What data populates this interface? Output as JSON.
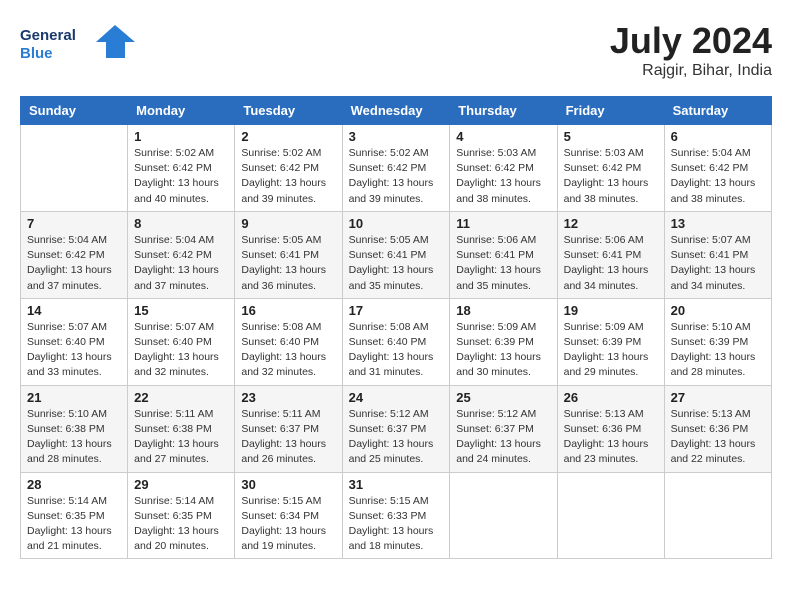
{
  "logo": {
    "line1": "General",
    "line2": "Blue"
  },
  "title": {
    "month_year": "July 2024",
    "location": "Rajgir, Bihar, India"
  },
  "days_of_week": [
    "Sunday",
    "Monday",
    "Tuesday",
    "Wednesday",
    "Thursday",
    "Friday",
    "Saturday"
  ],
  "weeks": [
    [
      {
        "day": "",
        "sunrise": "",
        "sunset": "",
        "daylight": ""
      },
      {
        "day": "1",
        "sunrise": "5:02 AM",
        "sunset": "6:42 PM",
        "daylight": "13 hours and 40 minutes."
      },
      {
        "day": "2",
        "sunrise": "5:02 AM",
        "sunset": "6:42 PM",
        "daylight": "13 hours and 39 minutes."
      },
      {
        "day": "3",
        "sunrise": "5:02 AM",
        "sunset": "6:42 PM",
        "daylight": "13 hours and 39 minutes."
      },
      {
        "day": "4",
        "sunrise": "5:03 AM",
        "sunset": "6:42 PM",
        "daylight": "13 hours and 38 minutes."
      },
      {
        "day": "5",
        "sunrise": "5:03 AM",
        "sunset": "6:42 PM",
        "daylight": "13 hours and 38 minutes."
      },
      {
        "day": "6",
        "sunrise": "5:04 AM",
        "sunset": "6:42 PM",
        "daylight": "13 hours and 38 minutes."
      }
    ],
    [
      {
        "day": "7",
        "sunrise": "5:04 AM",
        "sunset": "6:42 PM",
        "daylight": "13 hours and 37 minutes."
      },
      {
        "day": "8",
        "sunrise": "5:04 AM",
        "sunset": "6:42 PM",
        "daylight": "13 hours and 37 minutes."
      },
      {
        "day": "9",
        "sunrise": "5:05 AM",
        "sunset": "6:41 PM",
        "daylight": "13 hours and 36 minutes."
      },
      {
        "day": "10",
        "sunrise": "5:05 AM",
        "sunset": "6:41 PM",
        "daylight": "13 hours and 35 minutes."
      },
      {
        "day": "11",
        "sunrise": "5:06 AM",
        "sunset": "6:41 PM",
        "daylight": "13 hours and 35 minutes."
      },
      {
        "day": "12",
        "sunrise": "5:06 AM",
        "sunset": "6:41 PM",
        "daylight": "13 hours and 34 minutes."
      },
      {
        "day": "13",
        "sunrise": "5:07 AM",
        "sunset": "6:41 PM",
        "daylight": "13 hours and 34 minutes."
      }
    ],
    [
      {
        "day": "14",
        "sunrise": "5:07 AM",
        "sunset": "6:40 PM",
        "daylight": "13 hours and 33 minutes."
      },
      {
        "day": "15",
        "sunrise": "5:07 AM",
        "sunset": "6:40 PM",
        "daylight": "13 hours and 32 minutes."
      },
      {
        "day": "16",
        "sunrise": "5:08 AM",
        "sunset": "6:40 PM",
        "daylight": "13 hours and 32 minutes."
      },
      {
        "day": "17",
        "sunrise": "5:08 AM",
        "sunset": "6:40 PM",
        "daylight": "13 hours and 31 minutes."
      },
      {
        "day": "18",
        "sunrise": "5:09 AM",
        "sunset": "6:39 PM",
        "daylight": "13 hours and 30 minutes."
      },
      {
        "day": "19",
        "sunrise": "5:09 AM",
        "sunset": "6:39 PM",
        "daylight": "13 hours and 29 minutes."
      },
      {
        "day": "20",
        "sunrise": "5:10 AM",
        "sunset": "6:39 PM",
        "daylight": "13 hours and 28 minutes."
      }
    ],
    [
      {
        "day": "21",
        "sunrise": "5:10 AM",
        "sunset": "6:38 PM",
        "daylight": "13 hours and 28 minutes."
      },
      {
        "day": "22",
        "sunrise": "5:11 AM",
        "sunset": "6:38 PM",
        "daylight": "13 hours and 27 minutes."
      },
      {
        "day": "23",
        "sunrise": "5:11 AM",
        "sunset": "6:37 PM",
        "daylight": "13 hours and 26 minutes."
      },
      {
        "day": "24",
        "sunrise": "5:12 AM",
        "sunset": "6:37 PM",
        "daylight": "13 hours and 25 minutes."
      },
      {
        "day": "25",
        "sunrise": "5:12 AM",
        "sunset": "6:37 PM",
        "daylight": "13 hours and 24 minutes."
      },
      {
        "day": "26",
        "sunrise": "5:13 AM",
        "sunset": "6:36 PM",
        "daylight": "13 hours and 23 minutes."
      },
      {
        "day": "27",
        "sunrise": "5:13 AM",
        "sunset": "6:36 PM",
        "daylight": "13 hours and 22 minutes."
      }
    ],
    [
      {
        "day": "28",
        "sunrise": "5:14 AM",
        "sunset": "6:35 PM",
        "daylight": "13 hours and 21 minutes."
      },
      {
        "day": "29",
        "sunrise": "5:14 AM",
        "sunset": "6:35 PM",
        "daylight": "13 hours and 20 minutes."
      },
      {
        "day": "30",
        "sunrise": "5:15 AM",
        "sunset": "6:34 PM",
        "daylight": "13 hours and 19 minutes."
      },
      {
        "day": "31",
        "sunrise": "5:15 AM",
        "sunset": "6:33 PM",
        "daylight": "13 hours and 18 minutes."
      },
      {
        "day": "",
        "sunrise": "",
        "sunset": "",
        "daylight": ""
      },
      {
        "day": "",
        "sunrise": "",
        "sunset": "",
        "daylight": ""
      },
      {
        "day": "",
        "sunrise": "",
        "sunset": "",
        "daylight": ""
      }
    ]
  ]
}
